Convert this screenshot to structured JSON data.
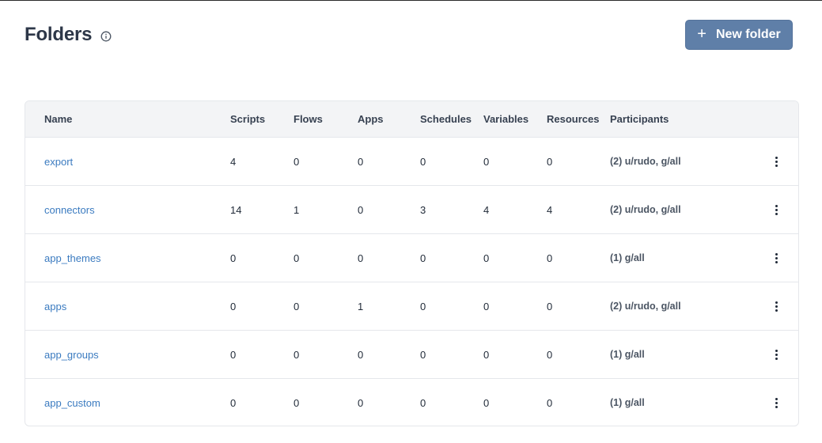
{
  "header": {
    "title": "Folders",
    "new_button_label": "New folder"
  },
  "table": {
    "columns": [
      "Name",
      "Scripts",
      "Flows",
      "Apps",
      "Schedules",
      "Variables",
      "Resources",
      "Participants"
    ],
    "rows": [
      {
        "name": "export",
        "scripts": "4",
        "flows": "0",
        "apps": "0",
        "schedules": "0",
        "variables": "0",
        "resources": "0",
        "participants": "(2) u/rudo, g/all"
      },
      {
        "name": "connectors",
        "scripts": "14",
        "flows": "1",
        "apps": "0",
        "schedules": "3",
        "variables": "4",
        "resources": "4",
        "participants": "(2) u/rudo, g/all"
      },
      {
        "name": "app_themes",
        "scripts": "0",
        "flows": "0",
        "apps": "0",
        "schedules": "0",
        "variables": "0",
        "resources": "0",
        "participants": "(1) g/all"
      },
      {
        "name": "apps",
        "scripts": "0",
        "flows": "0",
        "apps": "1",
        "schedules": "0",
        "variables": "0",
        "resources": "0",
        "participants": "(2) u/rudo, g/all"
      },
      {
        "name": "app_groups",
        "scripts": "0",
        "flows": "0",
        "apps": "0",
        "schedules": "0",
        "variables": "0",
        "resources": "0",
        "participants": "(1) g/all"
      },
      {
        "name": "app_custom",
        "scripts": "0",
        "flows": "0",
        "apps": "0",
        "schedules": "0",
        "variables": "0",
        "resources": "0",
        "participants": "(1) g/all"
      }
    ]
  },
  "icons": {
    "info": "info-icon",
    "plus": "plus-icon",
    "row_menu": "more-vertical-icon"
  },
  "colors": {
    "accent_button": "#5f7fa8",
    "link": "#3b7bc0",
    "header_bg": "#f3f4f6"
  }
}
